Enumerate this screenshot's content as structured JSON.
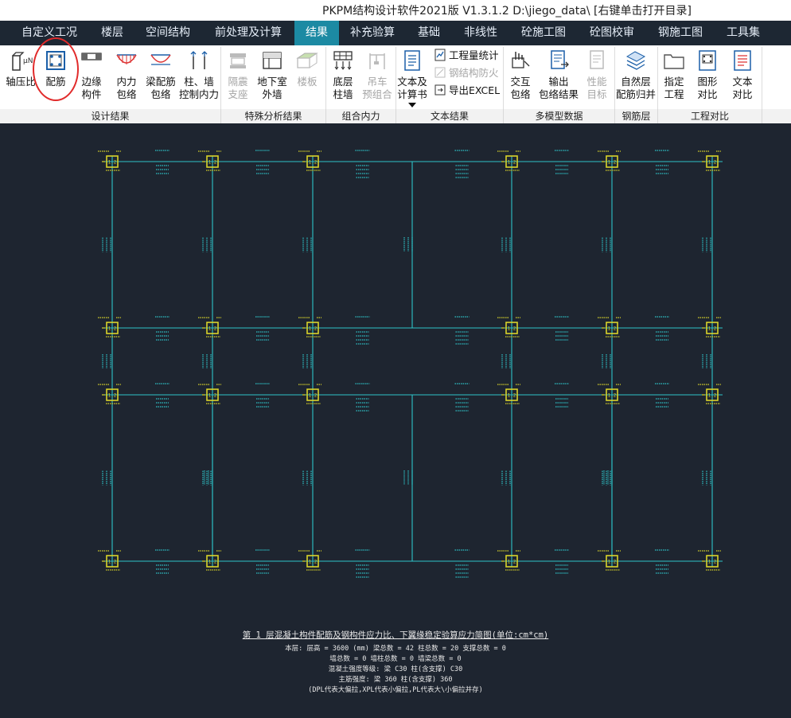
{
  "window": {
    "title": "PKPM结构设计软件2021版 V1.3.1.2 D:\\jiego_data\\ [右键单击打开目录]"
  },
  "menu": [
    {
      "label": "自定义工况"
    },
    {
      "label": "楼层"
    },
    {
      "label": "空间结构"
    },
    {
      "label": "前处理及计算"
    },
    {
      "label": "结果"
    },
    {
      "label": "补充验算"
    },
    {
      "label": "基础"
    },
    {
      "label": "非线性"
    },
    {
      "label": "砼施工图"
    },
    {
      "label": "砼图校审"
    },
    {
      "label": "钢施工图"
    },
    {
      "label": "工具集"
    }
  ],
  "ribbon": {
    "buttons": [
      {
        "label": "轴压比",
        "icon": "axial-ratio-icon"
      },
      {
        "label": "配筋",
        "icon": "reinforcement-icon"
      },
      {
        "label": "边缘\n构件",
        "icon": "edge-member-icon"
      },
      {
        "label": "内力\n包络",
        "icon": "force-envelope-icon"
      },
      {
        "label": "梁配筋\n包络",
        "icon": "beam-rebar-envelope-icon"
      },
      {
        "label": "柱、墙\n控制内力",
        "icon": "column-wall-force-icon"
      },
      {
        "label": "隔震\n支座",
        "icon": "isolation-bearing-icon"
      },
      {
        "label": "地下室\n外墙",
        "icon": "basement-wall-icon"
      },
      {
        "label": "楼板",
        "icon": "floor-slab-icon"
      },
      {
        "label": "底层\n柱墙",
        "icon": "bottom-column-wall-icon"
      },
      {
        "label": "吊车\n预组合",
        "icon": "crane-combination-icon"
      },
      {
        "label": "文本及\n计算书",
        "icon": "text-report-icon"
      },
      {
        "label": "交互\n包络",
        "icon": "interactive-envelope-icon"
      },
      {
        "label": "输出\n包络结果",
        "icon": "output-envelope-icon"
      },
      {
        "label": "性能\n目标",
        "icon": "performance-target-icon"
      },
      {
        "label": "自然层\n配筋归并",
        "icon": "layer-rebar-merge-icon"
      },
      {
        "label": "指定\n工程",
        "icon": "folder-icon"
      },
      {
        "label": "图形\n对比",
        "icon": "graphic-compare-icon"
      },
      {
        "label": "文本\n对比",
        "icon": "text-compare-icon"
      }
    ],
    "small_buttons": [
      {
        "label": "工程量统计"
      },
      {
        "label": "钢结构防火"
      },
      {
        "label": "导出EXCEL"
      }
    ],
    "groups": [
      {
        "label": "设计结果"
      },
      {
        "label": "特殊分析结果"
      },
      {
        "label": "组合内力"
      },
      {
        "label": "文本结果"
      },
      {
        "label": "多模型数据"
      },
      {
        "label": "钢筋层"
      },
      {
        "label": "工程对比"
      }
    ]
  },
  "drawing": {
    "column_label": "1.2",
    "notes": {
      "title": "第 1 层混凝土构件配筋及钢构件应力比、下翼缘稳定验算应力简图(单位:cm*cm)",
      "lines": [
        "本层: 层高 = 3600 (mm)  梁总数 = 42  柱总数 = 20  支撑总数 = 0",
        "墙总数 = 0  墙柱总数 = 0  墙梁总数 = 0",
        "混凝土强度等级: 梁 C30   柱(含支撑) C30",
        "主筋强度: 梁 360   柱(含支撑) 360",
        "(DPL代表大偏拉,XPL代表小偏拉,PL代表大\\小偏拉并存)"
      ]
    }
  },
  "colors": {
    "menubar": "#1d2733",
    "menu_active": "#1c8aa3",
    "canvas": "#1e2530",
    "beam": "#2ec4c8",
    "column": "#d9d42a",
    "highlight": "#e12b2b"
  }
}
